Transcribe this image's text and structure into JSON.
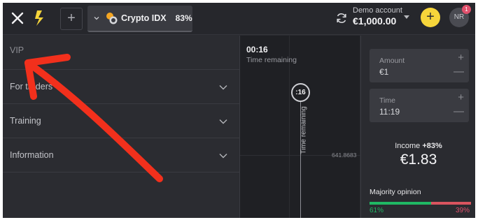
{
  "topbar": {
    "asset_name": "Crypto IDX",
    "asset_payout": "83%",
    "account_label": "Demo account",
    "account_balance": "€1,000.00",
    "avatar_initials": "NR",
    "notification_count": "1",
    "add_tab_symbol": "+",
    "deposit_symbol": "+"
  },
  "menu": {
    "items": [
      {
        "label": "VIP"
      },
      {
        "label": "For traders"
      },
      {
        "label": "Training"
      },
      {
        "label": "Information"
      }
    ]
  },
  "chart": {
    "time_value": "00:16",
    "time_label": "Time remaining",
    "expiry_badge": ":16",
    "vertical_label": "Time remaining",
    "price": "641.8683"
  },
  "panel": {
    "amount_label": "Amount",
    "amount_value": "€1",
    "time_label": "Time",
    "time_value": "11:19",
    "income_label": "Income",
    "income_pct": "+83%",
    "income_amount": "€1.83",
    "majority_label": "Majority opinion",
    "majority_up": "61%",
    "majority_down": "39%",
    "majority_up_fraction": 0.61
  },
  "colors": {
    "accent_yellow": "#f6d53b",
    "up_green": "#1fb864",
    "down_red": "#e0506c",
    "annotation_red": "#f2301c"
  }
}
